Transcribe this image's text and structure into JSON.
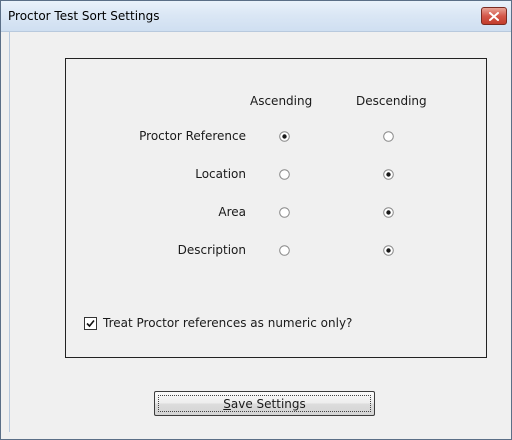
{
  "window": {
    "title": "Proctor Test Sort Settings"
  },
  "columns": {
    "ascending": "Ascending",
    "descending": "Descending"
  },
  "rows": [
    {
      "label": "Proctor Reference",
      "selected": "ascending"
    },
    {
      "label": "Location",
      "selected": "descending"
    },
    {
      "label": "Area",
      "selected": "descending"
    },
    {
      "label": "Description",
      "selected": "descending"
    }
  ],
  "numeric_option": {
    "label": "Treat Proctor references as numeric only?",
    "checked": true
  },
  "save_button": {
    "mnemonic": "S",
    "rest": "ave Settings"
  },
  "icons": {
    "close": "close-icon"
  }
}
